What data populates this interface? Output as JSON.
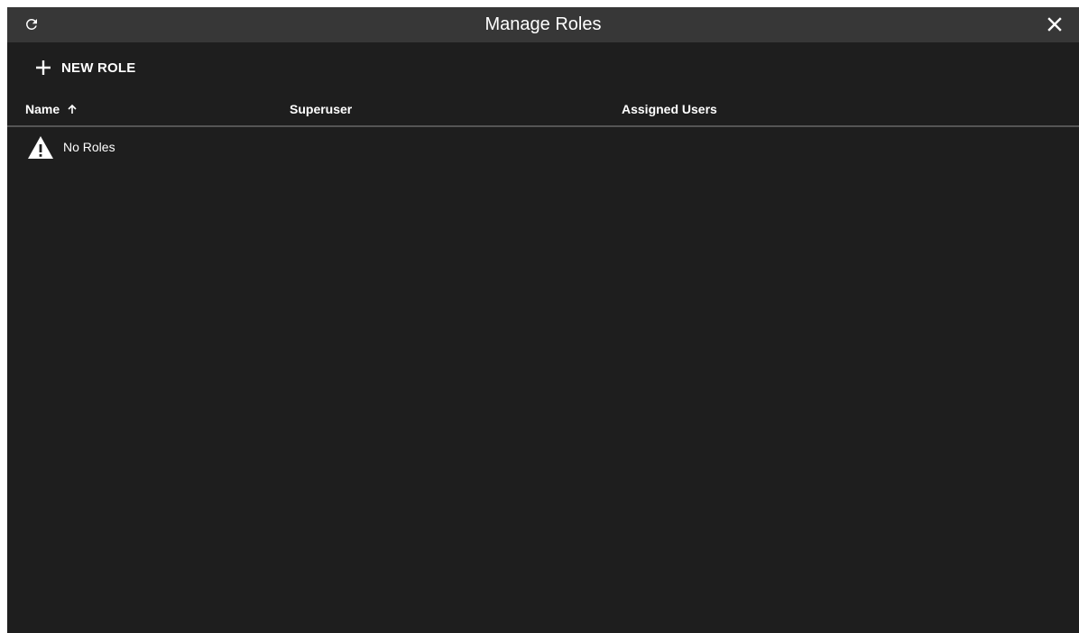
{
  "window": {
    "title": "Manage Roles"
  },
  "toolbar": {
    "new_role_label": "NEW ROLE"
  },
  "table": {
    "columns": [
      {
        "label": "Name",
        "sort": "ascending"
      },
      {
        "label": "Superuser"
      },
      {
        "label": "Assigned Users"
      }
    ],
    "empty_message": "No Roles"
  },
  "icons": {
    "refresh": "refresh-icon",
    "close": "close-icon",
    "add": "plus-icon",
    "sort": "arrow-up-icon",
    "warning": "warning-icon"
  },
  "colors": {
    "dialog_background": "#1e1e1e",
    "titlebar_background": "#373737",
    "text": "#ffffff",
    "divider": "#555555"
  }
}
